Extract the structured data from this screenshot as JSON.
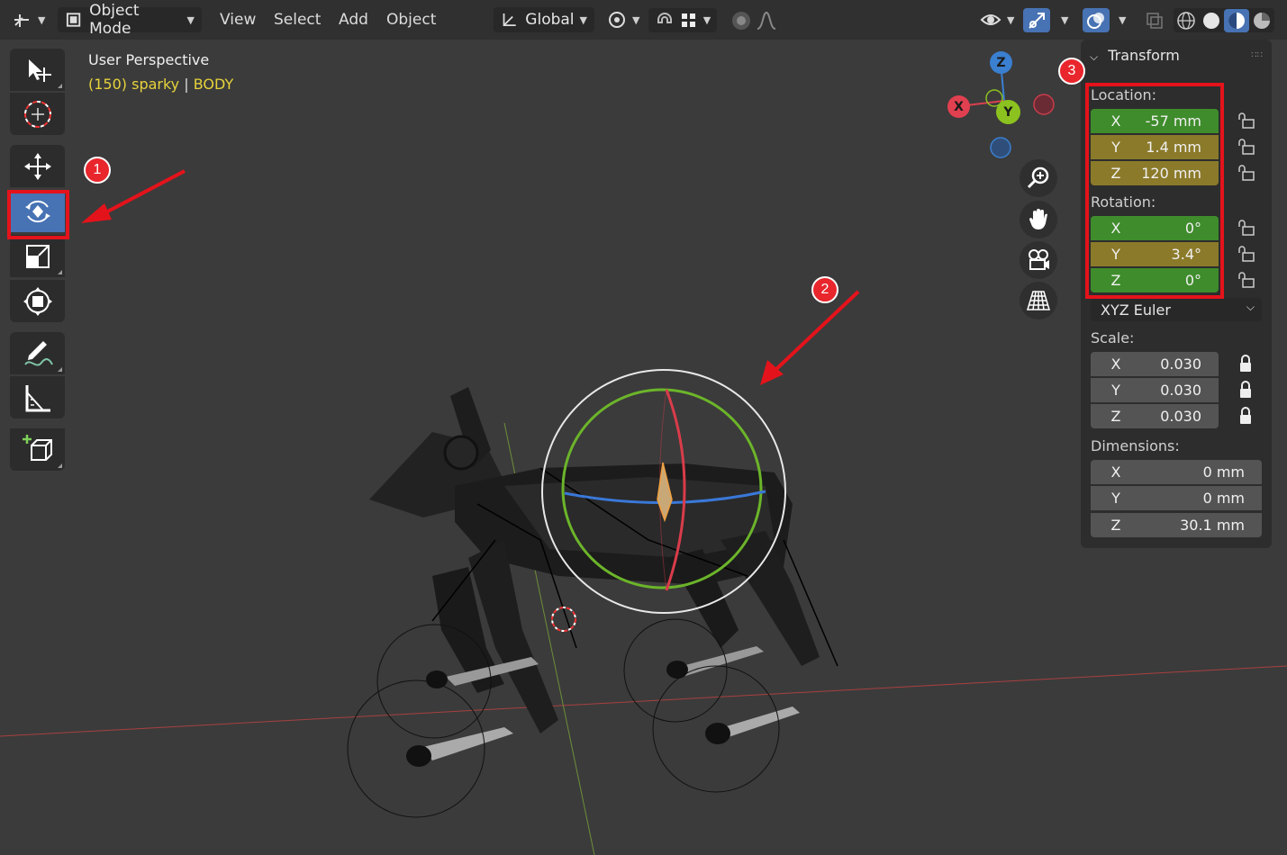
{
  "header": {
    "mode_label": "Object Mode",
    "menus": [
      "View",
      "Select",
      "Add",
      "Object"
    ],
    "orientation_label": "Global"
  },
  "viewport": {
    "view_name": "User Perspective",
    "frame_info": "(150) sparky",
    "object_name": "BODY"
  },
  "annotations": {
    "badge_1": "1",
    "badge_2": "2",
    "badge_3": "3",
    "highlight_color": "#e4131b"
  },
  "gizmo": {
    "z_label": "Z",
    "y_label": "Y",
    "x_label": "X"
  },
  "panel": {
    "title": "Transform",
    "location_label": "Location:",
    "location": [
      {
        "axis": "X",
        "value": "-57 mm"
      },
      {
        "axis": "Y",
        "value": "1.4 mm"
      },
      {
        "axis": "Z",
        "value": "120 mm"
      }
    ],
    "rotation_label": "Rotation:",
    "rotation": [
      {
        "axis": "X",
        "value": "0°"
      },
      {
        "axis": "Y",
        "value": "3.4°"
      },
      {
        "axis": "Z",
        "value": "0°"
      }
    ],
    "rotation_mode": "XYZ Euler",
    "scale_label": "Scale:",
    "scale": [
      {
        "axis": "X",
        "value": "0.030"
      },
      {
        "axis": "Y",
        "value": "0.030"
      },
      {
        "axis": "Z",
        "value": "0.030"
      }
    ],
    "dimensions_label": "Dimensions:",
    "dimensions": [
      {
        "axis": "X",
        "value": "0 mm"
      },
      {
        "axis": "Y",
        "value": "0 mm"
      },
      {
        "axis": "Z",
        "value": "30.1 mm"
      }
    ]
  },
  "colors": {
    "accent": "#4772b3",
    "field_green": "#3f8c2c",
    "field_yellow": "#8b7a2a",
    "axis_x": "#e04050",
    "axis_y": "#8cc21f",
    "axis_z": "#3a7fd0"
  }
}
